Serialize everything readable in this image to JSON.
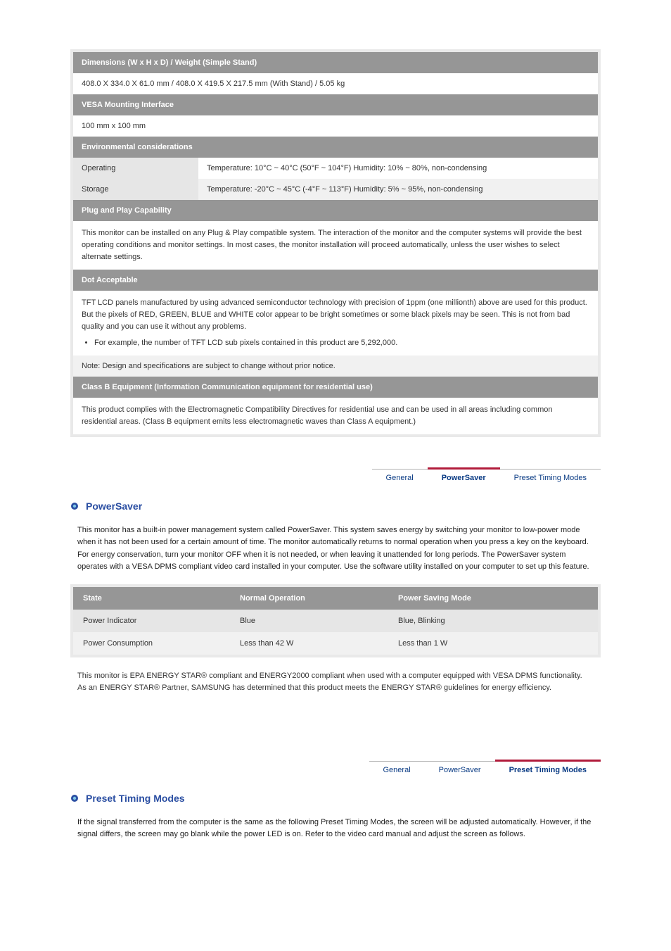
{
  "spec": {
    "dimensions_header": "Dimensions (W x H x D) / Weight (Simple Stand)",
    "dimensions_value": "408.0 X 334.0 X 61.0 mm / 408.0 X 419.5 X 217.5 mm (With Stand) / 5.05 kg",
    "vesa_header": "VESA Mounting Interface",
    "vesa_value": "100 mm x 100 mm",
    "env_header": "Environmental considerations",
    "op_label": "Operating",
    "op_value": "Temperature: 10°C ~ 40°C (50°F ~ 104°F) Humidity: 10% ~ 80%, non-condensing",
    "store_label": "Storage",
    "store_value": "Temperature: -20°C ~ 45°C (-4°F ~ 113°F) Humidity: 5% ~ 95%, non-condensing",
    "pnp_header": "Plug and Play Capability",
    "pnp_body": "This monitor can be installed on any Plug & Play compatible system. The interaction of the monitor and the computer systems will provide the best operating conditions and monitor settings. In most cases, the monitor installation will proceed automatically, unless the user wishes to select alternate settings.",
    "dot_header": "Dot Acceptable",
    "dot_body": "TFT LCD panels manufactured by using advanced semiconductor technology with precision of 1ppm (one millionth) above are used for this product. But the pixels of RED, GREEN, BLUE and WHITE color appear to be bright sometimes or some black pixels may be seen. This is not from bad quality and you can use it without any problems.",
    "dot_example": "For example, the number of TFT LCD sub pixels contained in this product are 5,292,000.",
    "note1": "Note: Design and specifications are subject to change without prior notice.",
    "classb_header": "Class B Equipment (Information Communication equipment for residential use)",
    "classb_body": "This product complies with the Electromagnetic Compatibility Directives for residential use and can be used in all areas including common residential areas. (Class B equipment emits less electromagnetic waves than Class A equipment.)"
  },
  "tabs": {
    "general": "General",
    "powersaver": "PowerSaver",
    "preset": "Preset Timing Modes"
  },
  "powersaver": {
    "title": "PowerSaver",
    "para": "This monitor has a built-in power management system called PowerSaver. This system saves energy by switching your monitor to low-power mode when it has not been used for a certain amount of time. The monitor automatically returns to normal operation when you press a key on the keyboard. For energy conservation, turn your monitor OFF when it is not needed, or when leaving it unattended for long periods. The PowerSaver system operates with a VESA DPMS compliant video card installed in your computer. Use the software utility installed on your computer to set up this feature.",
    "col_state": "State",
    "col_normal": "Normal Operation",
    "col_psm": "Power Saving Mode",
    "row_pi": "Power Indicator",
    "row_pi_normal": "Blue",
    "row_pi_psm": "Blue, Blinking",
    "row_pc": "Power Consumption",
    "row_pc_normal": "Less than 42 W",
    "row_pc_psm": "Less than 1 W",
    "footer": "This monitor is EPA ENERGY STAR® compliant and ENERGY2000 compliant when used with a computer equipped with VESA DPMS functionality.\nAs an ENERGY STAR® Partner, SAMSUNG has determined that this product meets the ENERGY STAR® guidelines for energy efficiency."
  },
  "preset": {
    "title": "Preset Timing Modes",
    "para": "If the signal transferred from the computer is the same as the following Preset Timing Modes, the screen will be adjusted automatically. However, if the signal differs, the screen may go blank while the power LED is on. Refer to the video card manual and adjust the screen as follows."
  }
}
